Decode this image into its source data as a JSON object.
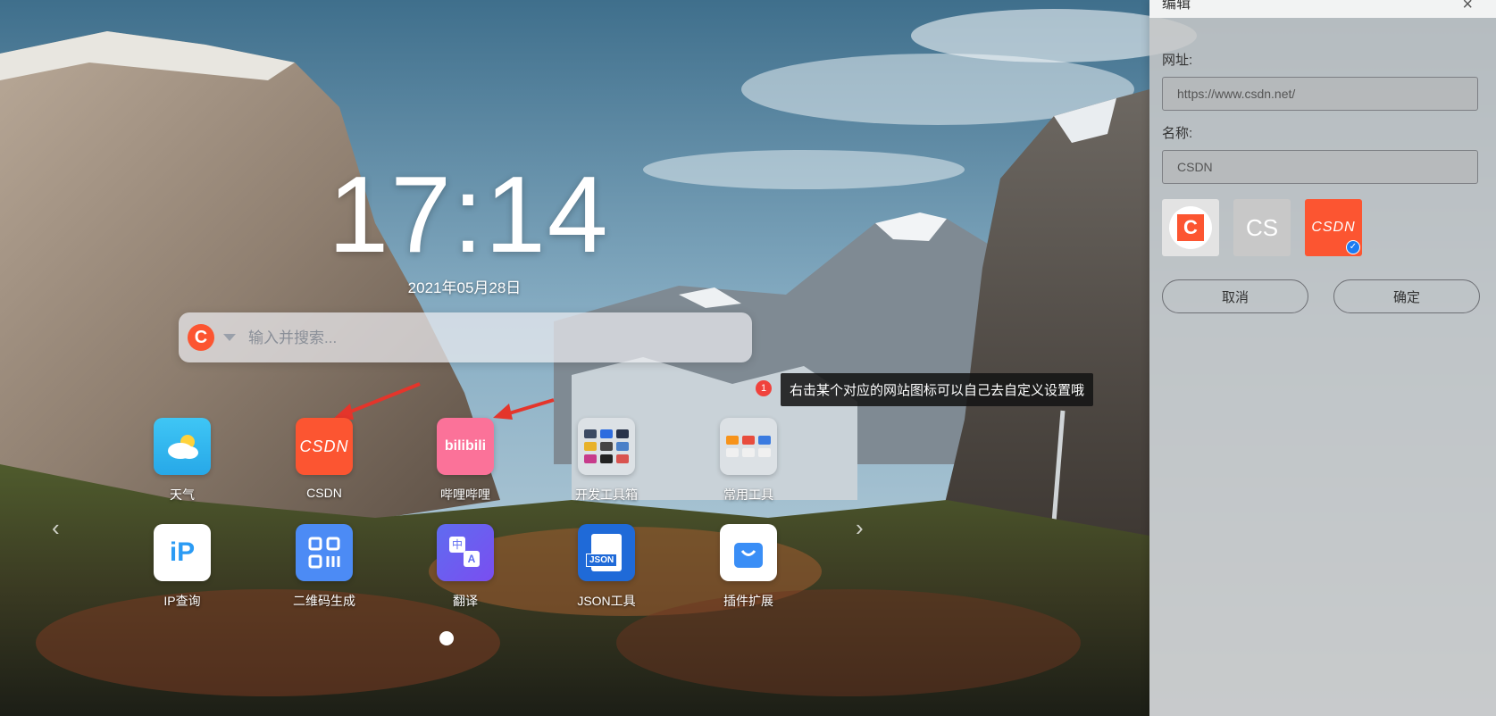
{
  "clock": {
    "time": "17:14",
    "date": "2021年05月28日"
  },
  "search": {
    "placeholder": "输入并搜索...",
    "engine_icon": "csdn-c-icon",
    "engine_letter": "C"
  },
  "tip": {
    "badge": "1",
    "text": "右击某个对应的网站图标可以自己去自定义设置哦"
  },
  "apps": [
    {
      "label": "天气",
      "icon": "weather-icon"
    },
    {
      "label": "CSDN",
      "icon": "csdn-logo-icon",
      "logo_text": "CSDN"
    },
    {
      "label": "哔哩哔哩",
      "icon": "bilibili-icon",
      "logo_text": "bilibili"
    },
    {
      "label": "开发工具箱",
      "icon": "folder-icon"
    },
    {
      "label": "常用工具",
      "icon": "folder-icon"
    },
    {
      "label": "IP查询",
      "icon": "ip-icon",
      "logo_text": "iP"
    },
    {
      "label": "二维码生成",
      "icon": "qrcode-icon"
    },
    {
      "label": "翻译",
      "icon": "translate-icon",
      "glyph_a": "中",
      "glyph_b": "A"
    },
    {
      "label": "JSON工具",
      "icon": "json-icon",
      "logo_text": "JSON"
    },
    {
      "label": "插件扩展",
      "icon": "shopping-bag-icon"
    }
  ],
  "pagination": {
    "pages": 1,
    "current": 1
  },
  "panel": {
    "title": "编辑",
    "close_label": "×",
    "url_label": "网址:",
    "url_value": "https://www.csdn.net/",
    "name_label": "名称:",
    "name_value": "CSDN",
    "icon_options": [
      {
        "type": "logo-c",
        "text": "C",
        "selected": false
      },
      {
        "type": "text",
        "text": "CS",
        "selected": false
      },
      {
        "type": "logo-csdn",
        "text": "CSDN",
        "selected": true
      }
    ],
    "cancel_label": "取消",
    "confirm_label": "确定"
  },
  "colors": {
    "csdn": "#fc5531",
    "bilibili": "#fb7299",
    "accent_blue": "#1e7cf2"
  }
}
